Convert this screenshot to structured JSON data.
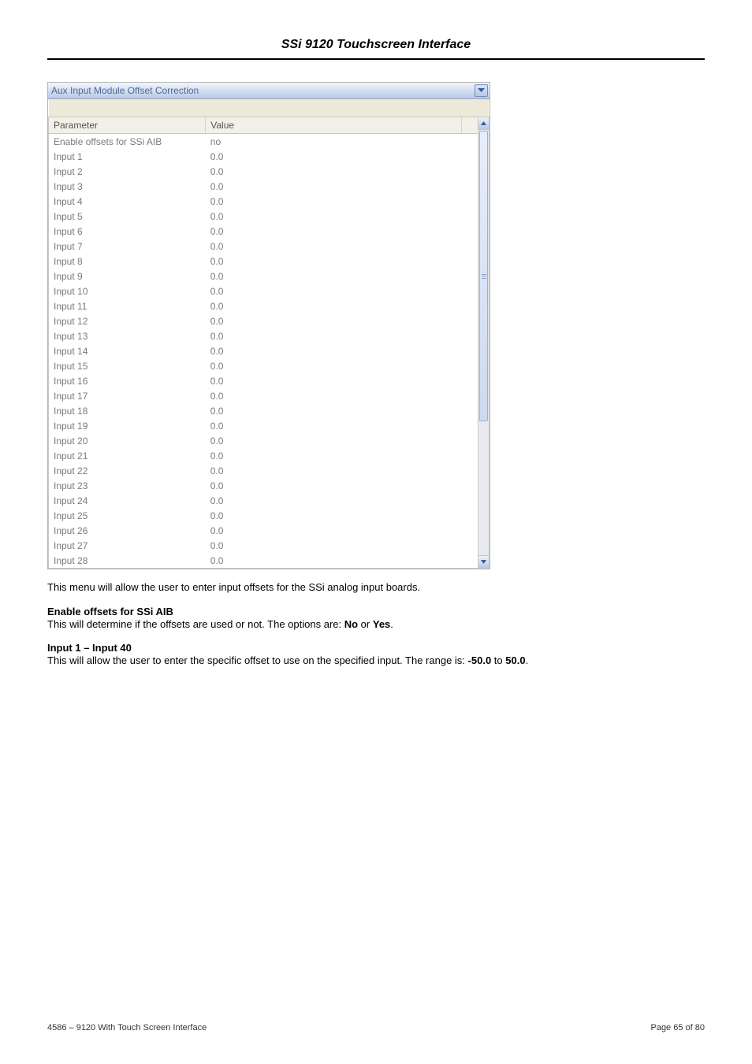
{
  "doc_title": "SSi 9120 Touchscreen Interface",
  "window": {
    "title": "Aux Input Module Offset Correction",
    "columns": {
      "param": "Parameter",
      "value": "Value"
    }
  },
  "rows": [
    {
      "param": "Enable offsets for SSi AIB",
      "value": "no"
    },
    {
      "param": "Input 1",
      "value": "0.0"
    },
    {
      "param": "Input 2",
      "value": "0.0"
    },
    {
      "param": "Input 3",
      "value": "0.0"
    },
    {
      "param": "Input 4",
      "value": "0.0"
    },
    {
      "param": "Input 5",
      "value": "0.0"
    },
    {
      "param": "Input 6",
      "value": "0.0"
    },
    {
      "param": "Input 7",
      "value": "0.0"
    },
    {
      "param": "Input 8",
      "value": "0.0"
    },
    {
      "param": "Input 9",
      "value": "0.0"
    },
    {
      "param": "Input 10",
      "value": "0.0"
    },
    {
      "param": "Input 11",
      "value": "0.0"
    },
    {
      "param": "Input 12",
      "value": "0.0"
    },
    {
      "param": "Input 13",
      "value": "0.0"
    },
    {
      "param": "Input 14",
      "value": "0.0"
    },
    {
      "param": "Input 15",
      "value": "0.0"
    },
    {
      "param": "Input 16",
      "value": "0.0"
    },
    {
      "param": "Input 17",
      "value": "0.0"
    },
    {
      "param": "Input 18",
      "value": "0.0"
    },
    {
      "param": "Input 19",
      "value": "0.0"
    },
    {
      "param": "Input 20",
      "value": "0.0"
    },
    {
      "param": "Input 21",
      "value": "0.0"
    },
    {
      "param": "Input 22",
      "value": "0.0"
    },
    {
      "param": "Input 23",
      "value": "0.0"
    },
    {
      "param": "Input 24",
      "value": "0.0"
    },
    {
      "param": "Input 25",
      "value": "0.0"
    },
    {
      "param": "Input 26",
      "value": "0.0"
    },
    {
      "param": "Input 27",
      "value": "0.0"
    },
    {
      "param": "Input 28",
      "value": "0.0"
    }
  ],
  "text": {
    "intro": "This menu will allow the user to enter input offsets for the SSi analog input boards.",
    "h1": "Enable offsets for SSi AIB",
    "p1a": "This will determine if the offsets are used or not.  The options are: ",
    "p1b_no": "No",
    "p1c_or": " or ",
    "p1d_yes": "Yes",
    "p1e_dot": ".",
    "h2": "Input 1 – Input 40",
    "p2a": "This will allow the user to enter the specific offset to use on the specified input.  The range is: ",
    "p2b_low": "-50.0",
    "p2c_to": " to ",
    "p2d_high": "50.0",
    "p2e_dot": "."
  },
  "footer": {
    "left": "4586 – 9120 With Touch Screen Interface",
    "right": "Page 65 of 80"
  },
  "icons": {
    "chev_down": "chevron-down-icon",
    "chev_up": "chevron-up-icon"
  }
}
